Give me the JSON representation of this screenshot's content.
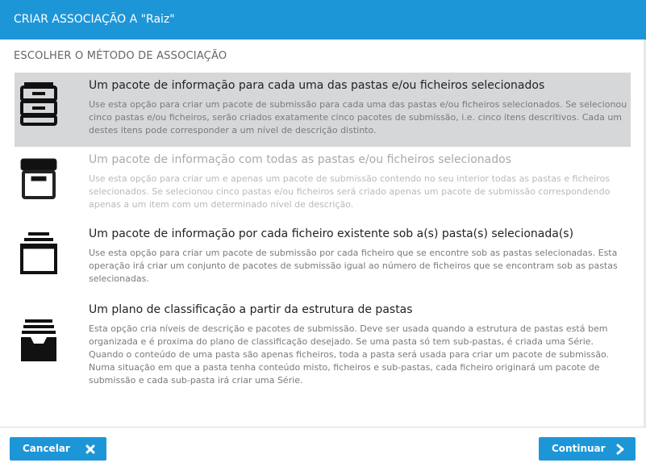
{
  "dialog": {
    "title": "CRIAR ASSOCIAÇÃO A \"Raiz\"",
    "section_title": "ESCOLHER O MÉTODO DE ASSOCIAÇÃO"
  },
  "options": [
    {
      "title": "Um pacote de informação para cada uma das pastas e/ou ficheiros selecionados",
      "description": "Use esta opção para criar um pacote de submissão para cada uma das pastas e/ou ficheiros selecionados. Se selecionou cinco pastas e/ou ficheiros, serão criados exatamente cinco pacotes de submissão, i.e. cinco itens descritivos. Cada um destes itens pode corresponder a um nível de descrição distinto.",
      "icon": "filing-drawers-icon",
      "selected": true,
      "enabled": true
    },
    {
      "title": "Um pacote de informação com todas as pastas e/ou ficheiros selecionados",
      "description": "Use esta opção para criar um e apenas um pacote de submissão contendo no seu interior todas as pastas e ficheiros selecionados. Se selecionou cinco pastas e/ou ficheiros será criado apenas um pacote de submissão correspondendo apenas a um item com um determinado nível de descrição.",
      "icon": "archive-box-icon",
      "selected": false,
      "enabled": false
    },
    {
      "title": "Um pacote de informação por cada ficheiro existente sob a(s) pasta(s) selecionada(s)",
      "description": "Use esta opção para criar um pacote de submissão por cada ficheiro que se encontre sob as pastas selecionadas. Esta operação irá criar um conjunto de pacotes de submissão igual ao número de ficheiros que se encontram sob as pastas selecionadas.",
      "icon": "open-tray-icon",
      "selected": false,
      "enabled": true
    },
    {
      "title": "Um plano de classificação a partir da estrutura de pastas",
      "description": "Esta opção cria níveis de descrição e pacotes de submissão. Deve ser usada quando a estrutura de pastas está bem organizada e é proxima do plano de classificação desejado. Se uma pasta só tem sub-pastas, é criada uma Série. Quando o conteúdo de uma pasta são apenas ficheiros, toda a pasta será usada para criar um pacote de submissão. Numa situação em que a pasta tenha conteúdo misto, ficheiros e sub-pastas, cada ficheiro originará um pacote de submissão e cada sub-pasta irá criar uma Série.",
      "icon": "inbox-tray-icon",
      "selected": false,
      "enabled": true
    }
  ],
  "footer": {
    "cancel_label": "Cancelar",
    "continue_label": "Continuar"
  },
  "colors": {
    "accent": "#1d96d8",
    "selected_bg": "#d6d7d9"
  }
}
